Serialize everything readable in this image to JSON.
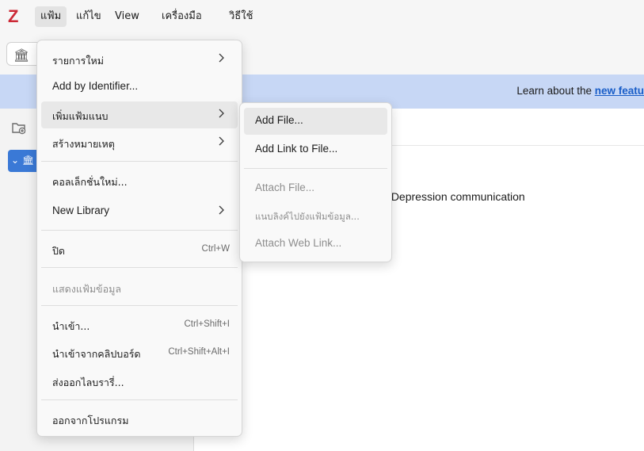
{
  "menubar": {
    "logo": "Z",
    "items": [
      {
        "label": "แฟ้ม"
      },
      {
        "label": "แก้ไข"
      },
      {
        "label": "View"
      },
      {
        "label": "เครื่องมือ"
      },
      {
        "label": "วิธีใช้"
      }
    ]
  },
  "banner": {
    "prefix": "Learn about the ",
    "link": "new featu"
  },
  "content": {
    "search_text": "ำ = Depression communication"
  },
  "file_menu": {
    "items": [
      {
        "label": "รายการใหม่",
        "has_submenu": true
      },
      {
        "label": "Add by Identifier..."
      },
      {
        "label": "เพิ่มแฟ้มแนบ",
        "has_submenu": true
      },
      {
        "label": "สร้างหมายเหตุ",
        "has_submenu": true
      },
      {
        "label": "คอลเล็กชั่นใหม่..."
      },
      {
        "label": "New Library",
        "has_submenu": true
      },
      {
        "label": "ปิด",
        "shortcut": "Ctrl+W"
      },
      {
        "label": "แสดงแฟ้มข้อมูล",
        "disabled": true
      },
      {
        "label": "นำเข้า...",
        "shortcut": "Ctrl+Shift+I"
      },
      {
        "label": "นำเข้าจากคลิปบอร์ด",
        "shortcut": "Ctrl+Shift+Alt+I"
      },
      {
        "label": "ส่งออกไลบรารี่..."
      },
      {
        "label": "ออกจากโปรแกรม"
      }
    ]
  },
  "attach_submenu": {
    "items": [
      {
        "label": "Add File..."
      },
      {
        "label": "Add Link to File..."
      },
      {
        "label": "Attach File...",
        "disabled": true
      },
      {
        "label": "แนบลิงค์ไปยังแฟ้มข้อมูล...",
        "disabled": true
      },
      {
        "label": "Attach Web Link...",
        "disabled": true
      }
    ]
  },
  "colors": {
    "logo": "#cc2936",
    "banner": "#c7d7f5",
    "link": "#1a5ec8",
    "selection": "#3a79d6"
  }
}
